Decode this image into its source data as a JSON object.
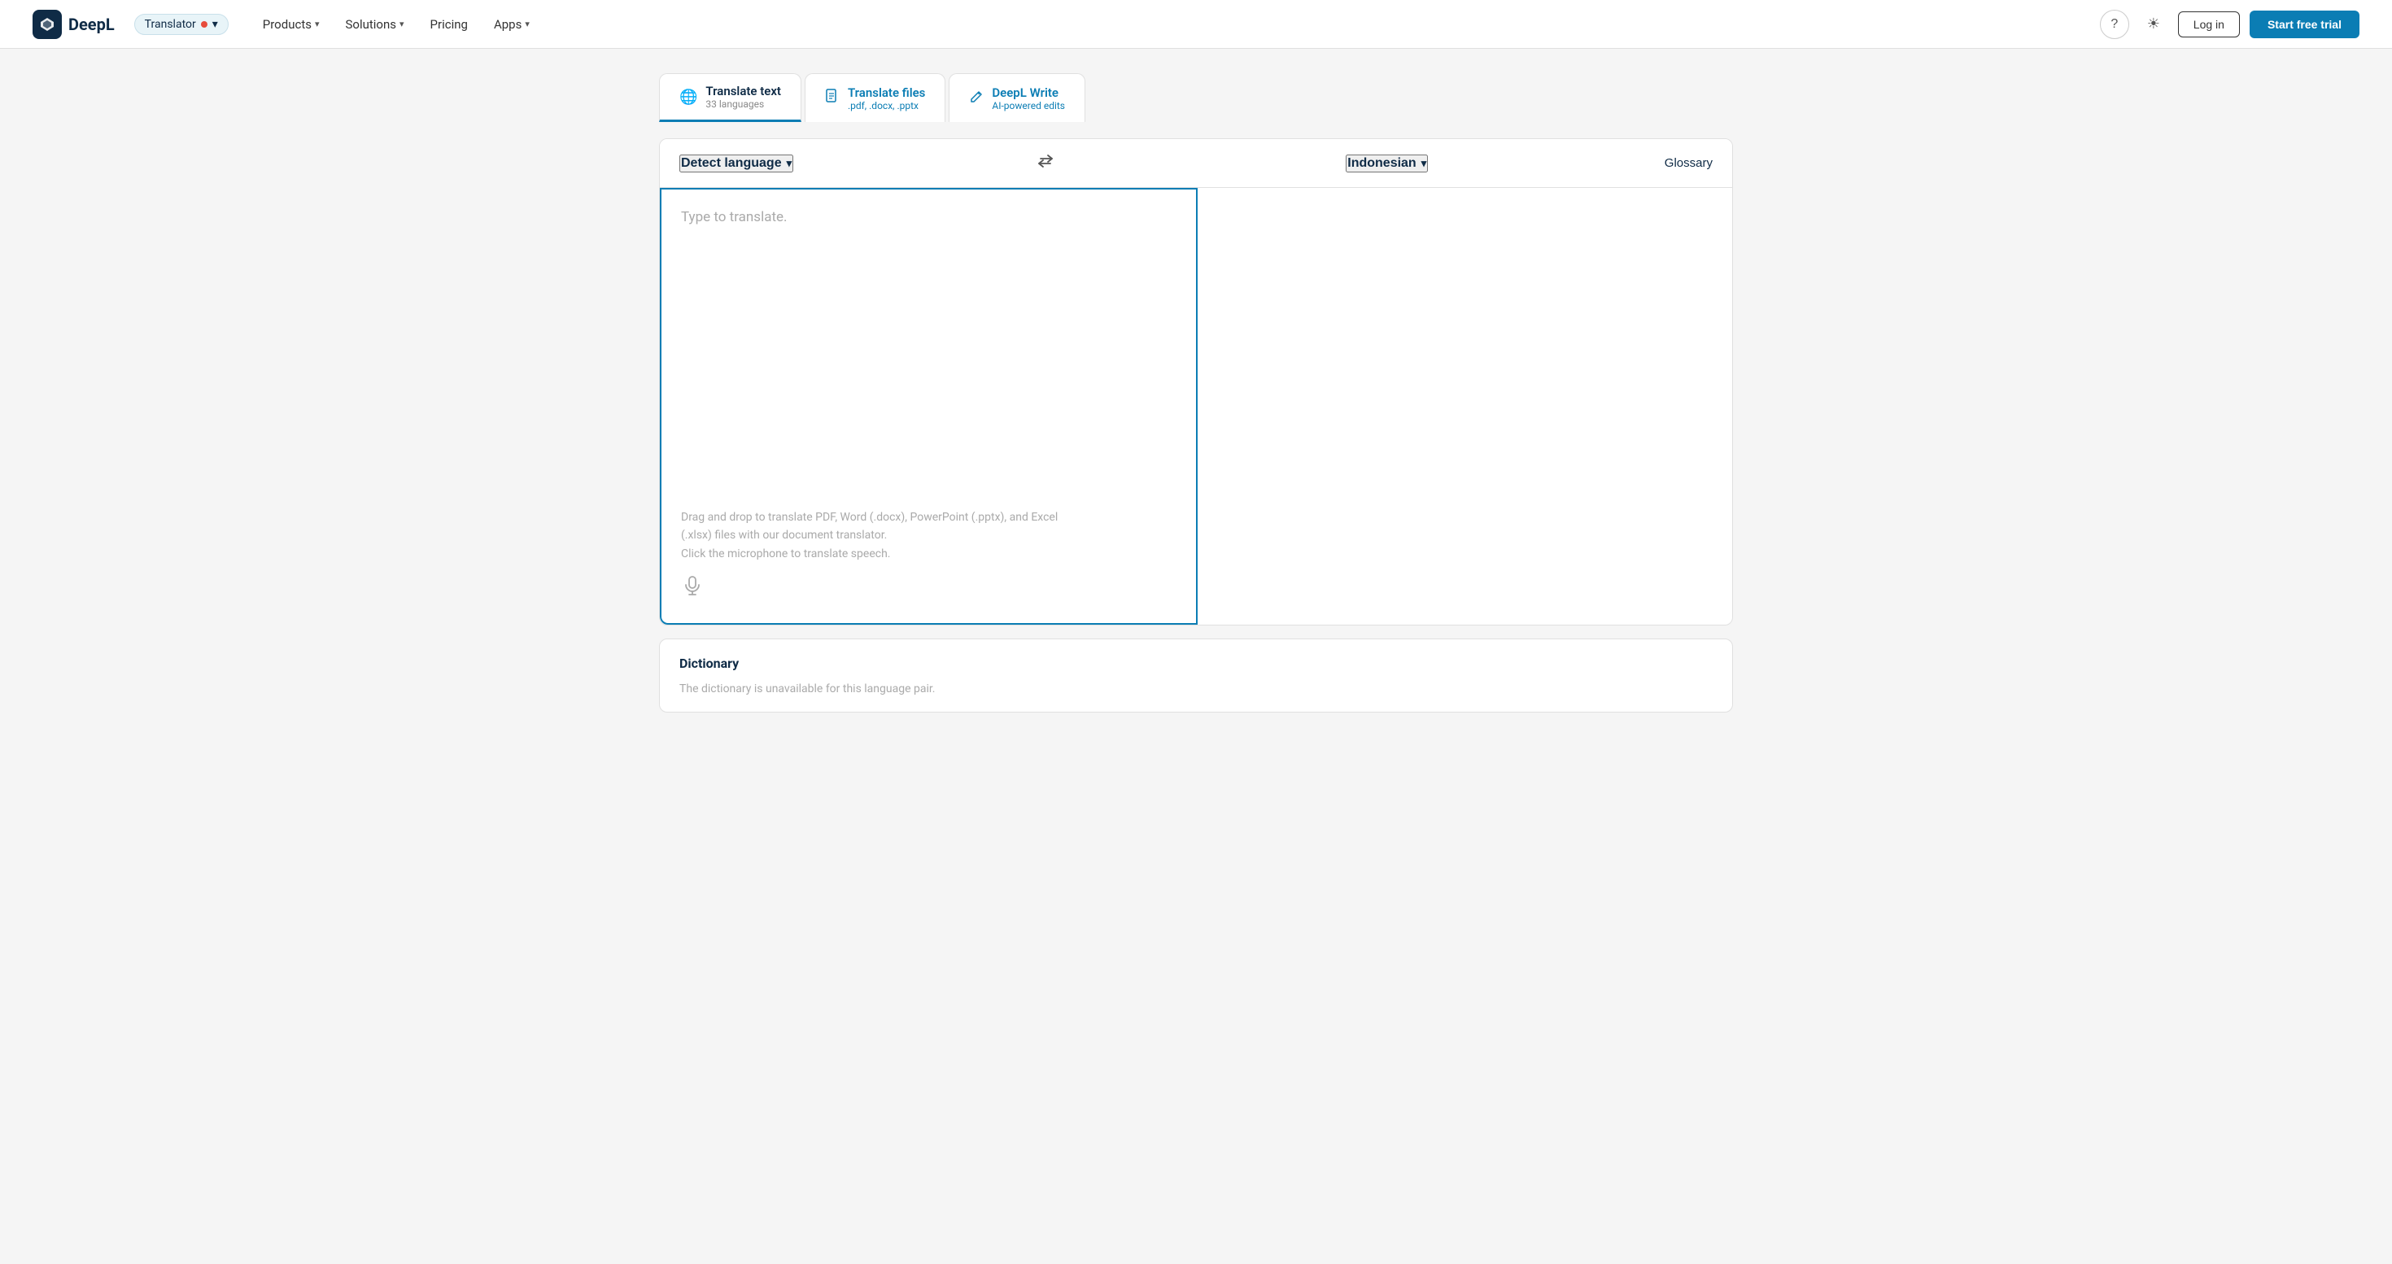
{
  "navbar": {
    "logo_text": "DeepL",
    "logo_icon": "D",
    "translator_label": "Translator",
    "menu_items": [
      {
        "label": "Products",
        "has_chevron": true
      },
      {
        "label": "Solutions",
        "has_chevron": true
      },
      {
        "label": "Pricing",
        "has_chevron": false
      },
      {
        "label": "Apps",
        "has_chevron": true
      }
    ],
    "login_label": "Log in",
    "trial_label": "Start free trial",
    "help_icon": "?",
    "theme_icon": "☀"
  },
  "tabs": [
    {
      "id": "translate-text",
      "title": "Translate text",
      "subtitle": "33 languages",
      "icon": "🌐",
      "active": true
    },
    {
      "id": "translate-files",
      "title": "Translate files",
      "subtitle": ".pdf, .docx, .pptx",
      "icon": "📄",
      "active": false
    },
    {
      "id": "deepl-write",
      "title": "DeepL Write",
      "subtitle": "AI-powered edits",
      "icon": "✏",
      "active": false
    }
  ],
  "translator": {
    "source_lang": "Detect language",
    "target_lang": "Indonesian",
    "glossary_label": "Glossary",
    "placeholder": "Type to translate.",
    "hint_line1": "Drag and drop to translate PDF, Word (.docx), PowerPoint (.pptx), and Excel",
    "hint_line2": "(.xlsx) files with our document translator.",
    "hint_line3": "Click the microphone to translate speech.",
    "swap_icon": "⇄"
  },
  "dictionary": {
    "title": "Dictionary",
    "unavailable_msg": "The dictionary is unavailable for this language pair."
  },
  "colors": {
    "brand_blue": "#0b7db4",
    "dark_navy": "#0f2b46",
    "accent_red": "#e74c3c"
  }
}
